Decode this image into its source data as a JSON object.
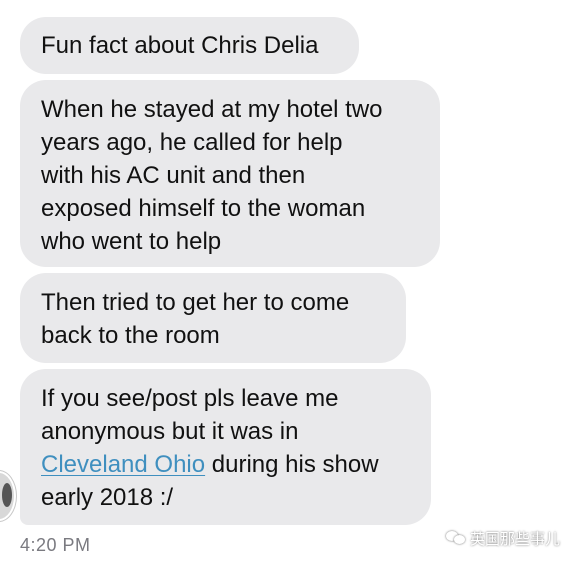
{
  "messages": [
    {
      "text": "Fun fact about Chris Delia"
    },
    {
      "text": "When he stayed at my hotel two\nyears ago, he called for help\nwith his AC unit and then\nexposed himself to the woman\nwho went to help"
    },
    {
      "text": "Then tried to get her to come\nback to the room"
    },
    {
      "text_before": "If you see/post pls leave me\nanonymous but it was in\n",
      "link": "Cleveland Ohio",
      "text_after": " during his show\nearly 2018 :/"
    }
  ],
  "timestamp": "4:20 PM",
  "watermark": "英国那些事儿",
  "colors": {
    "bubble_background": "#e9e9eb",
    "link": "#3f8fbf",
    "timestamp": "#7a7a80"
  },
  "icons": {
    "avatar": "sender-avatar",
    "watermark": "wechat-icon"
  }
}
